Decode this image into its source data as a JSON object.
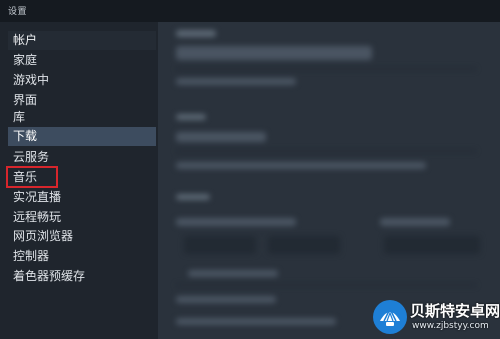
{
  "window": {
    "title": "设置"
  },
  "sidebar": {
    "items": [
      {
        "label": "帐户"
      },
      {
        "label": "家庭"
      },
      {
        "label": "游戏中"
      },
      {
        "label": "界面"
      },
      {
        "label": "库"
      },
      {
        "label": "下载"
      },
      {
        "label": "云服务"
      },
      {
        "label": "音乐"
      },
      {
        "label": "实况直播"
      },
      {
        "label": "远程畅玩"
      },
      {
        "label": "网页浏览器"
      },
      {
        "label": "控制器"
      },
      {
        "label": "着色器预缓存"
      }
    ],
    "selected": "下载",
    "annotated": "音乐"
  },
  "watermark": {
    "name": "贝斯特安卓网",
    "url": "www.zjbstyy.com"
  },
  "colors": {
    "background": "#1b2129",
    "sidebar": "#1f252d",
    "selected": "#3d4c5f",
    "annotation": "#d7262c"
  }
}
